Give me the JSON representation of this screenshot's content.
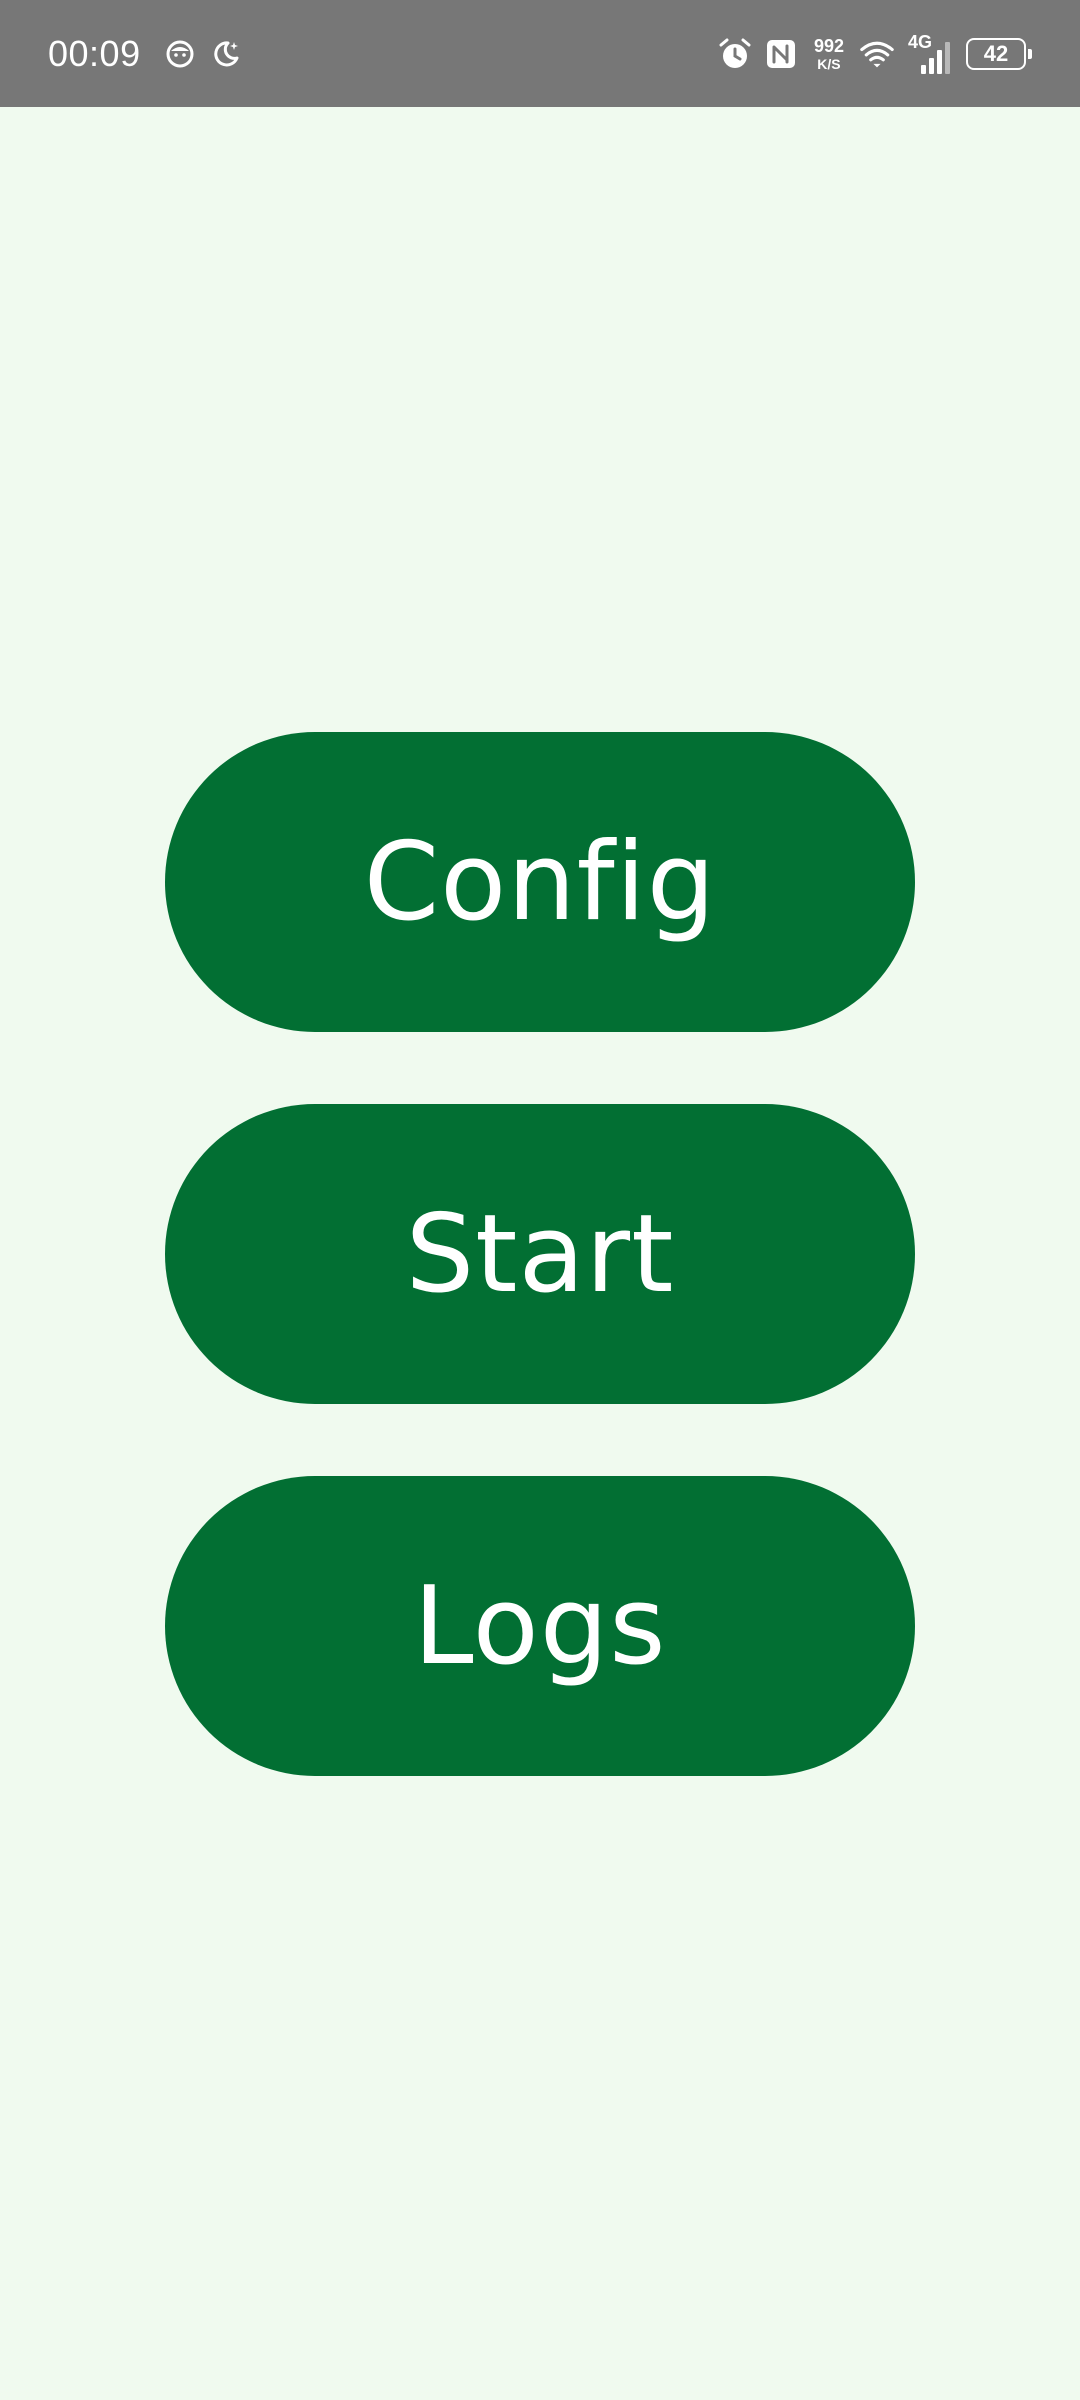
{
  "status_bar": {
    "time": "00:09",
    "left_icons": [
      "face-notification-icon",
      "moon-icon"
    ],
    "right_icons": [
      "alarm-icon",
      "nfc-icon",
      "wifi-icon"
    ],
    "net_speed_value": "992",
    "net_speed_unit": "K/S",
    "network_type": "4G",
    "signal_level": 3,
    "battery_level": "42"
  },
  "menu": {
    "config_label": "Config",
    "start_label": "Start",
    "logs_label": "Logs"
  },
  "colors": {
    "background": "#f0faef",
    "button": "#026f33",
    "button_text": "#ffffff",
    "status_bar": "#777777"
  }
}
